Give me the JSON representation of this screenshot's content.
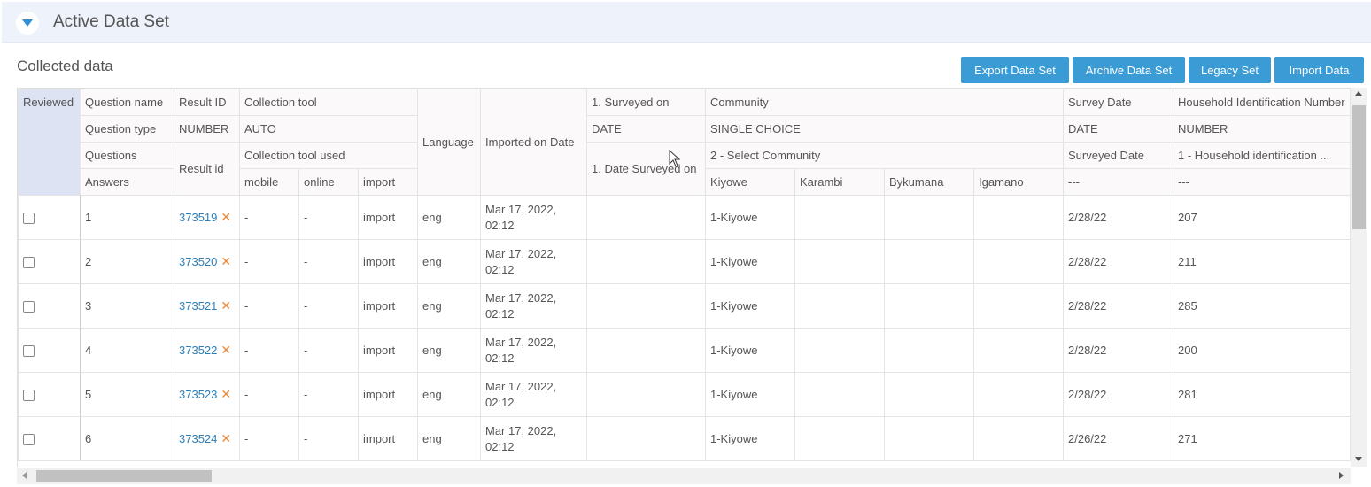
{
  "panel": {
    "title": "Active Data Set"
  },
  "section": {
    "title": "Collected data"
  },
  "toolbar": {
    "export_label": "Export Data Set",
    "archive_label": "Archive Data Set",
    "legacy_label": "Legacy Set",
    "import_label": "Import Data"
  },
  "colors": {
    "accent": "#3a9bd5",
    "link": "#2a7fb8",
    "delete": "#e8873a",
    "header_bg": "#eef2fb"
  },
  "header": {
    "reviewed": "Reviewed",
    "row_labels": [
      "Question name",
      "Question type",
      "Questions",
      "Answers"
    ],
    "result_id": "Result ID",
    "result_type": "NUMBER",
    "result_id_label": "Result id",
    "collection_tool": "Collection tool",
    "collection_tool_type": "AUTO",
    "collection_tool_used": "Collection tool used",
    "tool_options": [
      "mobile",
      "online",
      "import"
    ],
    "language": "Language",
    "imported_on": "Imported on Date",
    "surveyed_on": "1. Surveyed on",
    "surveyed_type": "DATE",
    "surveyed_question": "1. Date Surveyed on",
    "community": "Community",
    "community_type": "SINGLE CHOICE",
    "community_question": "2 - Select Community",
    "community_answers": [
      "Kiyowe",
      "Karambi",
      "Bykumana",
      "Igamano"
    ],
    "survey_date": "Survey Date",
    "survey_date_type": "DATE",
    "survey_date_question": "Surveyed Date",
    "survey_date_answer": "---",
    "household": "Household Identification Number",
    "household_type": "NUMBER",
    "household_question": "1 - Household identification ...",
    "household_answer": "---"
  },
  "rows": [
    {
      "num": "1",
      "result_id": "373519",
      "mobile": "-",
      "online": "-",
      "import": "import",
      "language": "eng",
      "imported_on": "Mar 17, 2022, 02:12",
      "surveyed_on": "",
      "kiyowe": "1-Kiyowe",
      "karambi": "",
      "bykumana": "",
      "igamano": "",
      "survey_date": "2/28/22",
      "household": "207"
    },
    {
      "num": "2",
      "result_id": "373520",
      "mobile": "-",
      "online": "-",
      "import": "import",
      "language": "eng",
      "imported_on": "Mar 17, 2022, 02:12",
      "surveyed_on": "",
      "kiyowe": "1-Kiyowe",
      "karambi": "",
      "bykumana": "",
      "igamano": "",
      "survey_date": "2/28/22",
      "household": "211"
    },
    {
      "num": "3",
      "result_id": "373521",
      "mobile": "-",
      "online": "-",
      "import": "import",
      "language": "eng",
      "imported_on": "Mar 17, 2022, 02:12",
      "surveyed_on": "",
      "kiyowe": "1-Kiyowe",
      "karambi": "",
      "bykumana": "",
      "igamano": "",
      "survey_date": "2/28/22",
      "household": "285"
    },
    {
      "num": "4",
      "result_id": "373522",
      "mobile": "-",
      "online": "-",
      "import": "import",
      "language": "eng",
      "imported_on": "Mar 17, 2022, 02:12",
      "surveyed_on": "",
      "kiyowe": "1-Kiyowe",
      "karambi": "",
      "bykumana": "",
      "igamano": "",
      "survey_date": "2/28/22",
      "household": "200"
    },
    {
      "num": "5",
      "result_id": "373523",
      "mobile": "-",
      "online": "-",
      "import": "import",
      "language": "eng",
      "imported_on": "Mar 17, 2022, 02:12",
      "surveyed_on": "",
      "kiyowe": "1-Kiyowe",
      "karambi": "",
      "bykumana": "",
      "igamano": "",
      "survey_date": "2/28/22",
      "household": "281"
    },
    {
      "num": "6",
      "result_id": "373524",
      "mobile": "-",
      "online": "-",
      "import": "import",
      "language": "eng",
      "imported_on": "Mar 17, 2022, 02:12",
      "surveyed_on": "",
      "kiyowe": "1-Kiyowe",
      "karambi": "",
      "bykumana": "",
      "igamano": "",
      "survey_date": "2/26/22",
      "household": "271"
    }
  ]
}
